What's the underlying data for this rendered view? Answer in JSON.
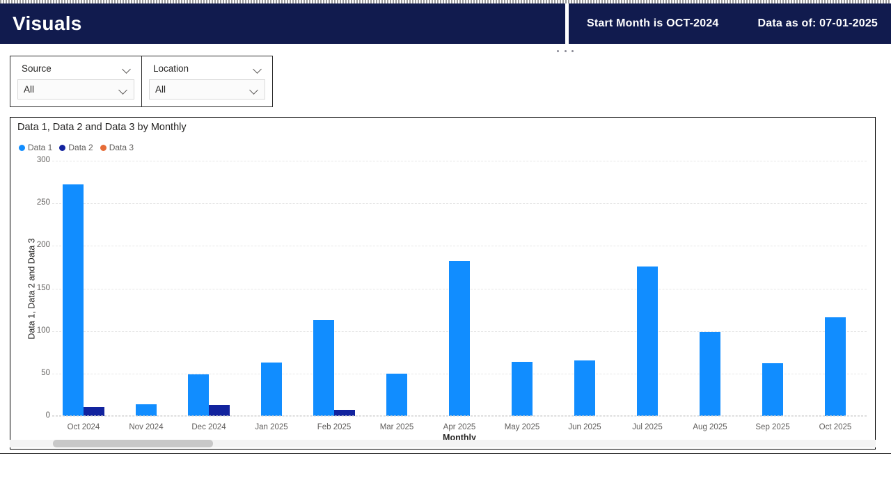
{
  "header": {
    "title": "Visuals",
    "start_month": "Start Month is OCT-2024",
    "data_as_of": "Data as of: 07-01-2025",
    "bg_color": "#111b4e",
    "text_color": "#ffffff"
  },
  "more_options": {
    "icon": "ellipsis-icon"
  },
  "slicers": [
    {
      "name": "source",
      "label": "Source",
      "value": "All",
      "chevron_icon": "chevron-down-icon"
    },
    {
      "name": "location",
      "label": "Location",
      "value": "All",
      "chevron_icon": "chevron-down-icon"
    }
  ],
  "chart_data": {
    "type": "bar",
    "title": "Data 1, Data 2 and Data 3 by Monthly",
    "xlabel": "Monthly",
    "ylabel": "Data 1, Data 2 and Data 3",
    "ylim": [
      0,
      300
    ],
    "yticks": [
      300,
      250,
      200,
      150,
      100,
      50,
      0
    ],
    "grid": true,
    "legend_position": "top-left",
    "categories": [
      "Oct 2024",
      "Nov 2024",
      "Dec 2024",
      "Jan 2025",
      "Feb 2025",
      "Mar 2025",
      "Apr 2025",
      "May 2025",
      "Jun 2025",
      "Jul 2025",
      "Aug 2025",
      "Sep 2025",
      "Oct 2025"
    ],
    "series": [
      {
        "name": "Data 1",
        "color": "#118dff",
        "values": [
          272,
          14,
          49,
          63,
          113,
          50,
          182,
          64,
          65,
          176,
          99,
          62,
          116
        ]
      },
      {
        "name": "Data 2",
        "color": "#12239e",
        "values": [
          11,
          0,
          13,
          0,
          7,
          0,
          0,
          0,
          0,
          0,
          0,
          0,
          0
        ]
      },
      {
        "name": "Data 3",
        "color": "#e66c37",
        "values": [
          0,
          0,
          0,
          0,
          0,
          0,
          0,
          0,
          0,
          0,
          0,
          0,
          0
        ]
      }
    ]
  },
  "scrollbar": {
    "name": "horizontal-scrollbar",
    "thumb_left_pct": 5,
    "thumb_width_pct": 18.5
  }
}
